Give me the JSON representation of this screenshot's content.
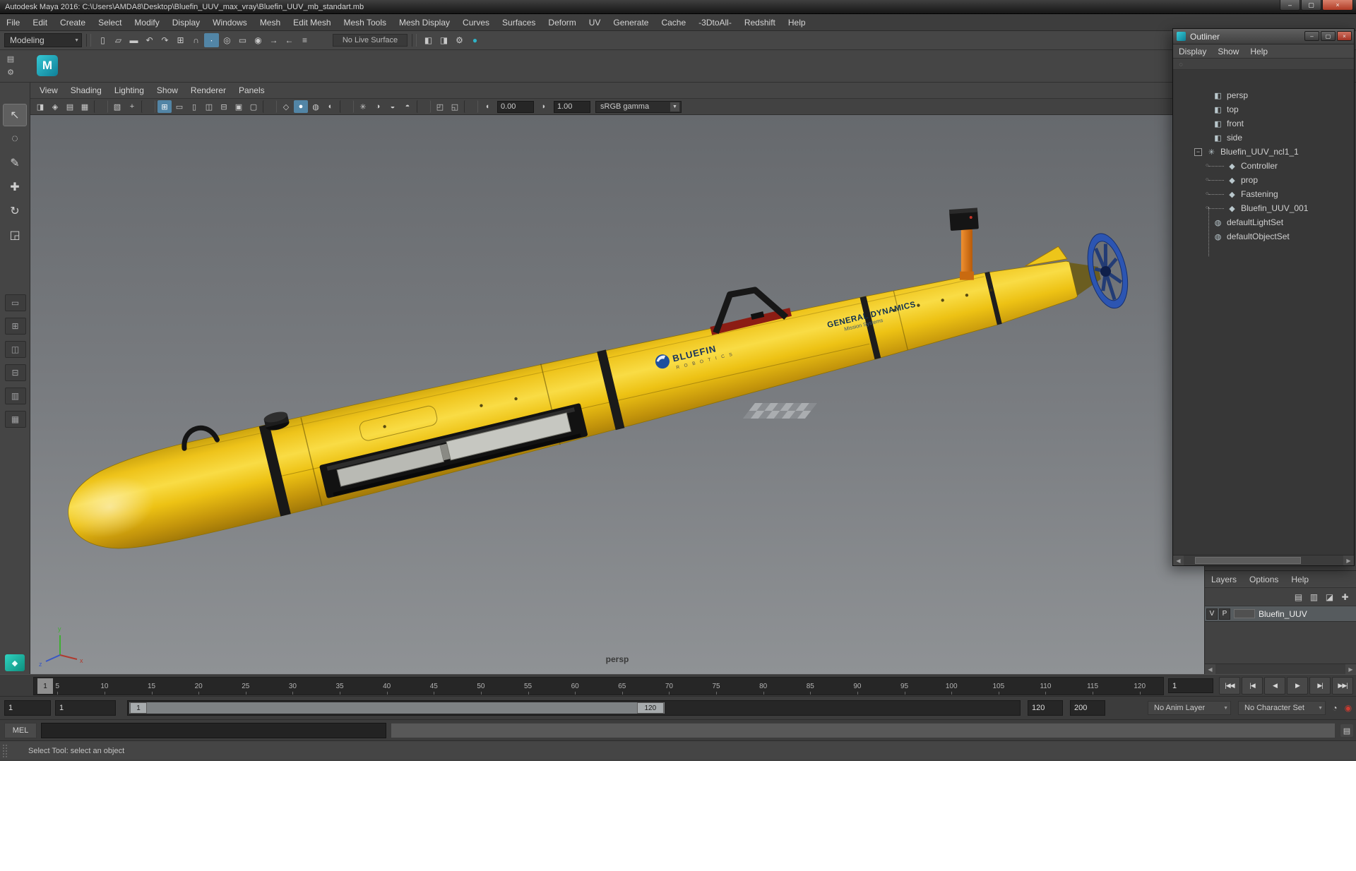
{
  "window": {
    "title": "Autodesk Maya 2016: C:\\Users\\AMDA8\\Desktop\\Bluefin_UUV_max_vray\\Bluefin_UUV_mb_standart.mb",
    "buttons": [
      "minimize",
      "restore",
      "close"
    ]
  },
  "colors": {
    "accent": "#5285a6",
    "close_red": "#b03a25",
    "teal": "#2fb3c7",
    "hull_yellow": "#f0c419",
    "prop_blue": "#2c55b2"
  },
  "menu_bar": [
    "File",
    "Edit",
    "Create",
    "Select",
    "Modify",
    "Display",
    "Windows",
    "Mesh",
    "Edit Mesh",
    "Mesh Tools",
    "Mesh Display",
    "Curves",
    "Surfaces",
    "Deform",
    "UV",
    "Generate",
    "Cache",
    "-3DtoAll-",
    "Redshift",
    "Help"
  ],
  "status_line": {
    "mode": "Modeling",
    "live_surface": "No Live Surface",
    "icons_left": [
      {
        "icon": "new-scene-icon"
      },
      {
        "icon": "open-scene-icon"
      },
      {
        "icon": "save-scene-icon"
      },
      {
        "icon": "undo-icon",
        "cls": "sepbefore"
      },
      {
        "icon": "redo-icon"
      },
      {
        "icon": "snap-to-grid-icon",
        "cls": "sepbefore"
      },
      {
        "icon": "snap-to-curve-icon"
      },
      {
        "icon": "snap-to-point-icon",
        "cls": "active"
      },
      {
        "icon": "snap-to-projected-center-icon"
      },
      {
        "icon": "snap-to-view-plane-icon"
      },
      {
        "icon": "make-live-icon",
        "cls": "sepbefore"
      },
      {
        "icon": "input-connections-icon"
      },
      {
        "icon": "output-connections-icon"
      },
      {
        "icon": "construction-history-icon"
      }
    ],
    "icons_right": [
      {
        "icon": "render-frame-icon"
      },
      {
        "icon": "ipr-render-icon"
      },
      {
        "icon": "render-settings-icon"
      },
      {
        "icon": "render-view-icon",
        "cls": "teal"
      }
    ]
  },
  "shelf": {
    "side_icons": [
      {
        "icon": "shelf-tabs-icon"
      },
      {
        "icon": "shelf-options-icon"
      }
    ]
  },
  "toolbox": {
    "tools": [
      {
        "icon": "select-tool-icon",
        "cls": "active"
      },
      {
        "icon": "lasso-tool-icon"
      },
      {
        "icon": "paint-select-tool-icon"
      },
      {
        "icon": "move-tool-icon"
      },
      {
        "icon": "rotate-tool-icon"
      },
      {
        "icon": "scale-tool-icon"
      }
    ],
    "layouts": [
      {
        "icon": "layout-single-icon"
      },
      {
        "icon": "layout-four-icon"
      },
      {
        "icon": "layout-three-top-icon"
      },
      {
        "icon": "layout-three-side-icon"
      },
      {
        "icon": "layout-two-icon"
      },
      {
        "icon": "layout-outliner-icon"
      }
    ]
  },
  "viewport": {
    "menus": [
      "View",
      "Shading",
      "Lighting",
      "Show",
      "Renderer",
      "Panels"
    ],
    "toolbar": {
      "icons": [
        {
          "icon": "vp-select-camera-icon"
        },
        {
          "icon": "vp-lock-camera-icon"
        },
        {
          "icon": "vp-camera-attributes-icon"
        },
        {
          "icon": "vp-bookmarks-icon"
        },
        {
          "cls": "vsep"
        },
        {
          "icon": "vp-image-plane-icon"
        },
        {
          "icon": "vp-2d-pan-zoom-icon"
        },
        {
          "cls": "vsep"
        },
        {
          "icon": "vp-grid-icon",
          "cls": "active"
        },
        {
          "icon": "vp-film-gate-icon"
        },
        {
          "icon": "vp-resolution-gate-icon"
        },
        {
          "icon": "vp-gate-mask-icon"
        },
        {
          "icon": "vp-field-chart-icon"
        },
        {
          "icon": "vp-safe-action-icon"
        },
        {
          "icon": "vp-safe-title-icon"
        },
        {
          "cls": "vsep"
        },
        {
          "icon": "vp-wireframe-icon"
        },
        {
          "icon": "vp-shaded-icon",
          "cls": "active"
        },
        {
          "icon": "vp-textured-icon"
        },
        {
          "icon": "vp-use-default-material-icon"
        },
        {
          "cls": "vsep"
        },
        {
          "icon": "vp-lighting-icon"
        },
        {
          "icon": "vp-shadows-icon"
        },
        {
          "icon": "vp-ssao-icon"
        },
        {
          "icon": "vp-motion-blur-icon"
        },
        {
          "cls": "vsep"
        },
        {
          "icon": "vp-isolate-select-icon"
        },
        {
          "icon": "vp-xray-icon"
        },
        {
          "cls": "vsep"
        },
        {
          "icon": "vp-exposure-icon"
        }
      ],
      "exposure": "0.00",
      "gamma": "1.00",
      "gamma_icon": "vp-gamma-icon",
      "view_transform": "sRGB gamma"
    },
    "camera_label": "persp",
    "axis": {
      "x": "x",
      "y": "y",
      "z": "z"
    }
  },
  "model": {
    "brand": "BLUEFIN",
    "brand_sub": "R O B O T I C S",
    "maker": "GENERAL DYNAMICS",
    "maker_sub": "Mission Systems"
  },
  "outliner": {
    "title": "Outliner",
    "menus": [
      "Display",
      "Show",
      "Help"
    ],
    "items": [
      {
        "label": "persp",
        "icon": "camera-icon",
        "cls": "lvl1"
      },
      {
        "label": "top",
        "icon": "camera-icon",
        "cls": "lvl1"
      },
      {
        "label": "front",
        "icon": "camera-icon",
        "cls": "lvl1"
      },
      {
        "label": "side",
        "icon": "camera-icon",
        "cls": "lvl1"
      },
      {
        "label": "Bluefin_UUV_ncl1_1",
        "icon": "transform-icon",
        "cls": "root"
      },
      {
        "label": "Controller",
        "icon": "mesh-icon",
        "cls": "lvl2"
      },
      {
        "label": "prop",
        "icon": "mesh-icon",
        "cls": "lvl2"
      },
      {
        "label": "Fastening",
        "icon": "mesh-icon",
        "cls": "lvl2"
      },
      {
        "label": "Bluefin_UUV_001",
        "icon": "mesh-icon",
        "cls": "lvl2"
      },
      {
        "label": "defaultLightSet",
        "icon": "light-set-icon",
        "cls": "lvl1"
      },
      {
        "label": "defaultObjectSet",
        "icon": "object-set-icon",
        "cls": "lvl1"
      }
    ]
  },
  "layer_editor": {
    "menus": [
      "Layers",
      "Options",
      "Help"
    ],
    "icons": [
      {
        "icon": "layers-sort-icon"
      },
      {
        "icon": "layers-empty-icon"
      },
      {
        "icon": "layers-new-from-selected-icon"
      },
      {
        "icon": "layers-new-icon"
      }
    ],
    "layer": {
      "visible": "V",
      "playback": "P",
      "name": "Bluefin_UUV"
    }
  },
  "time_slider": {
    "ticks": [
      5,
      10,
      15,
      20,
      25,
      30,
      35,
      40,
      45,
      50,
      55,
      60,
      65,
      70,
      75,
      80,
      85,
      90,
      95,
      100,
      105,
      110,
      115,
      120
    ],
    "current_frame": "1",
    "current_time_field": "1",
    "playback": [
      {
        "name": "go-to-start-button",
        "glyph": "|◀◀"
      },
      {
        "name": "step-back-frame-button",
        "glyph": "|◀"
      },
      {
        "name": "play-backwards-button",
        "glyph": "◀"
      },
      {
        "name": "play-forwards-button",
        "glyph": "▶"
      },
      {
        "name": "step-forward-frame-button",
        "glyph": "▶|"
      },
      {
        "name": "go-to-end-button",
        "glyph": "▶▶|"
      }
    ]
  },
  "range_slider": {
    "animation_start": "1",
    "playback_start": "1",
    "handle_start": "1",
    "handle_end": "120",
    "playback_end": "120",
    "animation_end": "200",
    "anim_layer": "No Anim Layer",
    "character_set": "No Character Set"
  },
  "command_line": {
    "label": "MEL"
  },
  "help_line": {
    "text": "Select Tool: select an object"
  },
  "icons": {
    "minimize-icon": "–",
    "restore-icon": "▢",
    "close-icon": "×",
    "dropdown-arrow-icon": "▼",
    "new-scene-icon": "▯",
    "open-scene-icon": "▱",
    "save-scene-icon": "▬",
    "undo-icon": "↶",
    "redo-icon": "↷",
    "snap-to-grid-icon": "⊞",
    "snap-to-curve-icon": "∩",
    "snap-to-point-icon": "∙",
    "snap-to-projected-center-icon": "◎",
    "snap-to-view-plane-icon": "▭",
    "make-live-icon": "◉",
    "input-connections-icon": "→",
    "output-connections-icon": "←",
    "construction-history-icon": "≡",
    "render-frame-icon": "◧",
    "ipr-render-icon": "◨",
    "render-settings-icon": "⚙",
    "render-view-icon": "●",
    "shelf-tabs-icon": "▤",
    "shelf-options-icon": "⚙",
    "maya-logo-icon": "M",
    "select-tool-icon": "↖",
    "lasso-tool-icon": "◌",
    "paint-select-tool-icon": "✎",
    "move-tool-icon": "✚",
    "rotate-tool-icon": "↻",
    "scale-tool-icon": "◲",
    "layout-single-icon": "▭",
    "layout-four-icon": "⊞",
    "layout-three-top-icon": "◫",
    "layout-three-side-icon": "⊟",
    "layout-two-icon": "▥",
    "layout-outliner-icon": "▦",
    "layout-hypershade-icon": "◆",
    "vp-select-camera-icon": "◨",
    "vp-lock-camera-icon": "◈",
    "vp-camera-attributes-icon": "▤",
    "vp-bookmarks-icon": "▦",
    "vp-image-plane-icon": "▧",
    "vp-2d-pan-zoom-icon": "+",
    "vp-grid-icon": "⊞",
    "vp-film-gate-icon": "▭",
    "vp-resolution-gate-icon": "▯",
    "vp-gate-mask-icon": "◫",
    "vp-field-chart-icon": "⊟",
    "vp-safe-action-icon": "▣",
    "vp-safe-title-icon": "▢",
    "vp-wireframe-icon": "◇",
    "vp-shaded-icon": "●",
    "vp-textured-icon": "◍",
    "vp-use-default-material-icon": "◐",
    "vp-lighting-icon": "✳",
    "vp-shadows-icon": "◑",
    "vp-ssao-icon": "◒",
    "vp-motion-blur-icon": "◓",
    "vp-isolate-select-icon": "◰",
    "vp-xray-icon": "◱",
    "vp-exposure-icon": "◖",
    "vp-gamma-ic": "◗",
    "camera-icon": "◧",
    "transform-icon": "✳",
    "mesh-icon": "◆",
    "light-set-icon": "◍",
    "object-set-icon": "◍",
    "expander-collapse-icon": "−",
    "outliner-filter-icon": "◌",
    "layers-sort-icon": "▤",
    "layers-empty-icon": "▥",
    "layers-new-from-selected-icon": "◪",
    "layers-new-icon": "✚",
    "clock-icon": "◔",
    "auto-key-icon": "◉",
    "script-editor-icon": "▤",
    "scroll-left-icon": "◀",
    "scroll-right-icon": "▶"
  }
}
